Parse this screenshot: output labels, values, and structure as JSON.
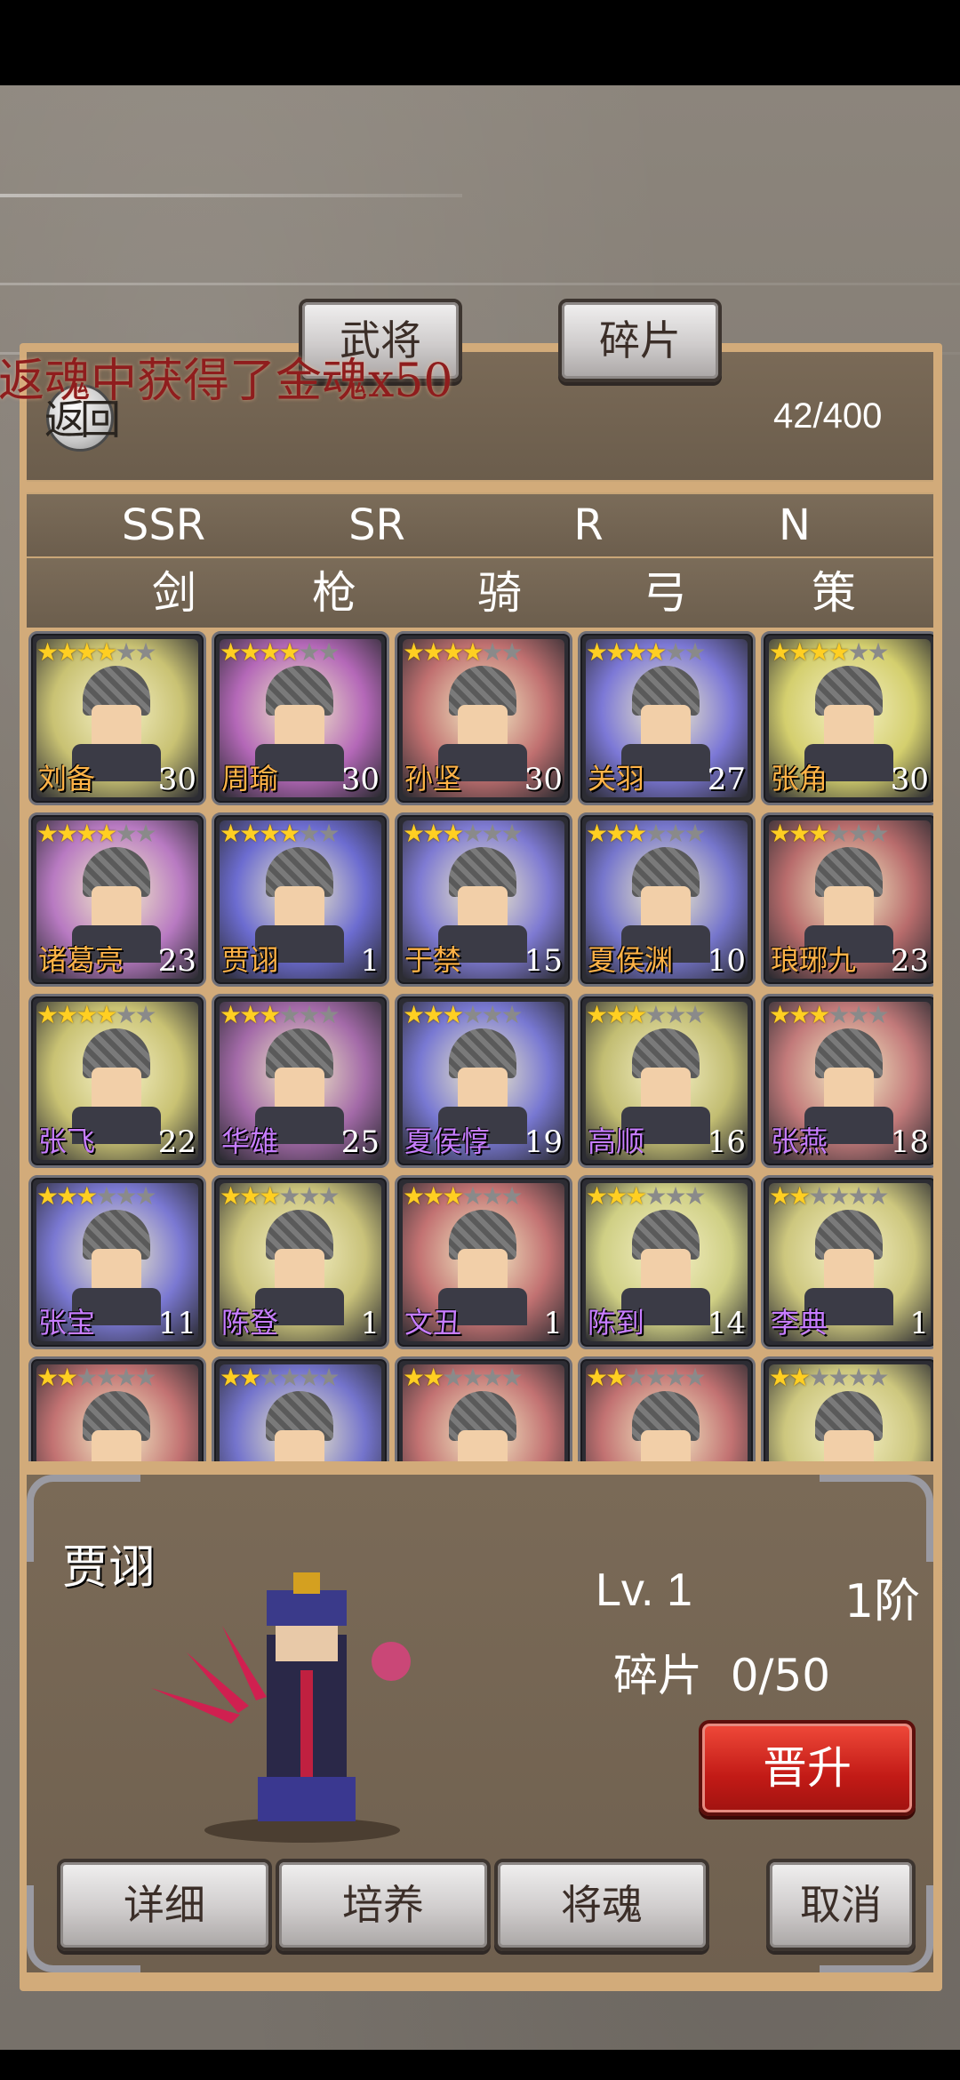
{
  "toast": "返魂中获得了金魂x50",
  "header": {
    "back_label": "返回",
    "tab_general": "武将",
    "tab_fragment": "碎片",
    "count": "42/400"
  },
  "rarity_tabs": [
    "SSR",
    "SR",
    "R",
    "N"
  ],
  "type_tabs": [
    "剑",
    "枪",
    "骑",
    "弓",
    "策"
  ],
  "cards": [
    {
      "name": "刘备",
      "count": "30",
      "stars": 4,
      "bg": "#c9c273",
      "name_color": "#ffb347"
    },
    {
      "name": "周瑜",
      "count": "30",
      "stars": 4,
      "bg": "#b468b8",
      "name_color": "#ffb347"
    },
    {
      "name": "孙坚",
      "count": "30",
      "stars": 4,
      "bg": "#c07070",
      "name_color": "#ffb347"
    },
    {
      "name": "关羽",
      "count": "27",
      "stars": 4,
      "bg": "#7c78d6",
      "name_color": "#ffb347"
    },
    {
      "name": "张角",
      "count": "30",
      "stars": 4,
      "bg": "#d4cf6e",
      "name_color": "#ffb347"
    },
    {
      "name": "诸葛亮",
      "count": "23",
      "stars": 4,
      "bg": "#b87ac2",
      "name_color": "#ffb347"
    },
    {
      "name": "贾诩",
      "count": "1",
      "stars": 4,
      "bg": "#6c6cd0",
      "name_color": "#ffb347"
    },
    {
      "name": "于禁",
      "count": "15",
      "stars": 3,
      "bg": "#7e7ad2",
      "name_color": "#ffb347"
    },
    {
      "name": "夏侯渊",
      "count": "10",
      "stars": 3,
      "bg": "#7676cc",
      "name_color": "#ffb347"
    },
    {
      "name": "琅琊九",
      "count": "23",
      "stars": 3,
      "bg": "#b86c6c",
      "name_color": "#ffb347"
    },
    {
      "name": "张飞",
      "count": "22",
      "stars": 4,
      "bg": "#c9c273",
      "name_color": "#c77dff"
    },
    {
      "name": "华雄",
      "count": "25",
      "stars": 3,
      "bg": "#a36aa8",
      "name_color": "#c77dff"
    },
    {
      "name": "夏侯惇",
      "count": "19",
      "stars": 3,
      "bg": "#7878d2",
      "name_color": "#c77dff"
    },
    {
      "name": "高顺",
      "count": "16",
      "stars": 3,
      "bg": "#c2bd72",
      "name_color": "#c77dff"
    },
    {
      "name": "张燕",
      "count": "18",
      "stars": 3,
      "bg": "#c27a7a",
      "name_color": "#c77dff"
    },
    {
      "name": "张宝",
      "count": "11",
      "stars": 3,
      "bg": "#7a78d2",
      "name_color": "#c77dff"
    },
    {
      "name": "陈登",
      "count": "1",
      "stars": 3,
      "bg": "#c9c27a",
      "name_color": "#c77dff"
    },
    {
      "name": "文丑",
      "count": "1",
      "stars": 3,
      "bg": "#c27272",
      "name_color": "#c77dff"
    },
    {
      "name": "陈到",
      "count": "14",
      "stars": 3,
      "bg": "#cfcf84",
      "name_color": "#c77dff"
    },
    {
      "name": "李典",
      "count": "1",
      "stars": 2,
      "bg": "#cdc77e",
      "name_color": "#c77dff"
    },
    {
      "name": "",
      "count": "",
      "stars": 2,
      "bg": "#c27272",
      "name_color": "#c77dff"
    },
    {
      "name": "",
      "count": "",
      "stars": 2,
      "bg": "#7474cc",
      "name_color": "#c77dff"
    },
    {
      "name": "",
      "count": "",
      "stars": 2,
      "bg": "#c27272",
      "name_color": "#c77dff"
    },
    {
      "name": "",
      "count": "",
      "stars": 2,
      "bg": "#c27272",
      "name_color": "#c77dff"
    },
    {
      "name": "",
      "count": "",
      "stars": 2,
      "bg": "#cdc77e",
      "name_color": "#c77dff"
    }
  ],
  "max_stars": 6,
  "selected": {
    "name": "贾诩",
    "level": "Lv. 1",
    "rank": "1阶",
    "fragments_label": "碎片",
    "fragments": "0/50",
    "upgrade_label": "晋升"
  },
  "actions": {
    "detail": "详细",
    "train": "培养",
    "soul": "将魂",
    "cancel": "取消"
  }
}
